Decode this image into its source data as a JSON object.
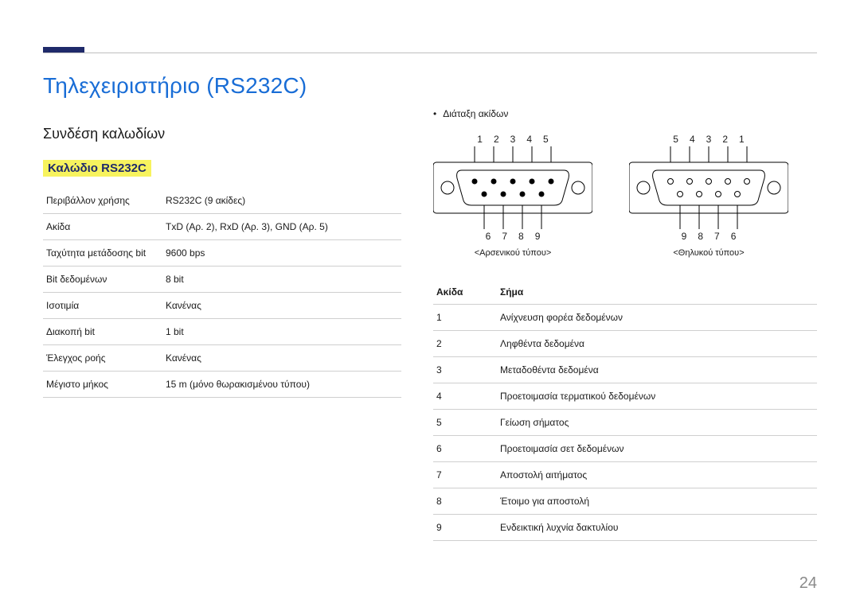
{
  "page_number": "24",
  "title": "Τηλεχειριστήριο (RS232C)",
  "subtitle": "Συνδέση καλωδίων",
  "section": "Καλώδιο RS232C",
  "spec": [
    {
      "k": "Περιβάλλον χρήσης",
      "v": "RS232C (9 ακίδες)"
    },
    {
      "k": "Ακίδα",
      "v": "TxD (Αρ. 2), RxD (Αρ. 3), GND (Αρ. 5)"
    },
    {
      "k": "Ταχύτητα μετάδοσης bit",
      "v": "9600 bps"
    },
    {
      "k": "Bit δεδομένων",
      "v": "8 bit"
    },
    {
      "k": "Ισοτιμία",
      "v": "Κανένας"
    },
    {
      "k": "Διακοπή bit",
      "v": "1 bit"
    },
    {
      "k": "Έλεγχος ροής",
      "v": "Κανένας"
    },
    {
      "k": "Μέγιστο μήκος",
      "v": "15 m (μόνο θωρακισμένου τύπου)"
    }
  ],
  "pin_arrangement_label": "Διάταξη ακίδων",
  "diagram_left": {
    "top": [
      "1",
      "2",
      "3",
      "4",
      "5"
    ],
    "bottom": [
      "6",
      "7",
      "8",
      "9"
    ],
    "caption": "<Αρσενικού τύπου>"
  },
  "diagram_right": {
    "top": [
      "5",
      "4",
      "3",
      "2",
      "1"
    ],
    "bottom": [
      "9",
      "8",
      "7",
      "6"
    ],
    "caption": "<Θηλυκού τύπου>"
  },
  "pins_header": {
    "c1": "Ακίδα",
    "c2": "Σήμα"
  },
  "pins": [
    {
      "n": "1",
      "s": "Ανίχνευση φορέα δεδομένων"
    },
    {
      "n": "2",
      "s": "Ληφθέντα δεδομένα"
    },
    {
      "n": "3",
      "s": "Μεταδοθέντα δεδομένα"
    },
    {
      "n": "4",
      "s": "Προετοιμασία τερματικού δεδομένων"
    },
    {
      "n": "5",
      "s": "Γείωση σήματος"
    },
    {
      "n": "6",
      "s": "Προετοιμασία σετ δεδομένων"
    },
    {
      "n": "7",
      "s": "Αποστολή αιτήματος"
    },
    {
      "n": "8",
      "s": "Έτοιμο για αποστολή"
    },
    {
      "n": "9",
      "s": "Ενδεικτική λυχνία δακτυλίου"
    }
  ]
}
